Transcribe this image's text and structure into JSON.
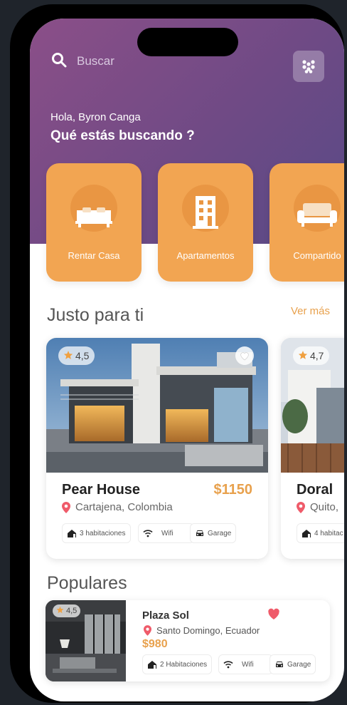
{
  "search": {
    "placeholder": "Buscar"
  },
  "greeting": {
    "hello": "Hola, Byron Canga",
    "question": "Qué estás buscando ?"
  },
  "categories": [
    {
      "label": "Rentar Casa",
      "icon": "bed-icon"
    },
    {
      "label": "Apartamentos",
      "icon": "building-icon"
    },
    {
      "label": "Compartido",
      "icon": "sofa-icon"
    }
  ],
  "featured": {
    "title": "Justo para ti",
    "more": "Ver más",
    "cards": [
      {
        "rating": "4,5",
        "name": "Pear House",
        "price": "$1150",
        "location": "Cartajena, Colombia",
        "amenities": [
          "3 habitaciones",
          "Wifi",
          "Garage"
        ]
      },
      {
        "rating": "4,7",
        "name": "Doral",
        "location": "Quito,",
        "amenities": [
          "4 habitac"
        ]
      }
    ]
  },
  "popular": {
    "title": "Populares",
    "item": {
      "rating": "4,5",
      "name": "Plaza Sol",
      "location": "Santo Domingo, Ecuador",
      "price": "$980",
      "amenities": [
        "2 Habitaciones",
        "Wifi",
        "Garage"
      ]
    }
  },
  "colors": {
    "accent": "#f2a552",
    "price": "#e8a14d",
    "hero_start": "#8b4f88",
    "hero_end": "#584a86",
    "pin": "#ef5b6a"
  }
}
